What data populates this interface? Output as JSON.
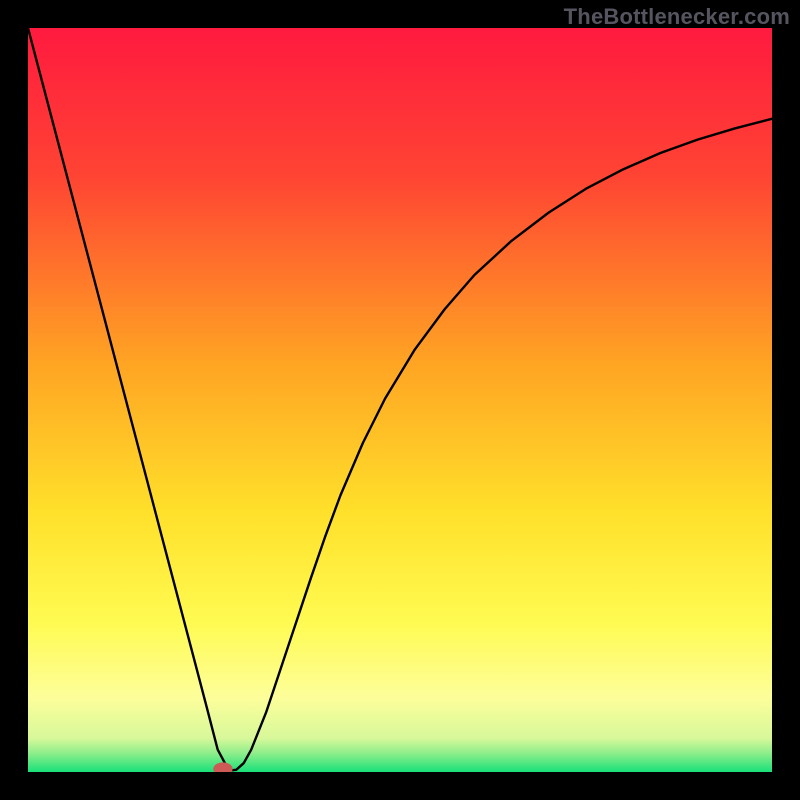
{
  "watermark": "TheBottlenecker.com",
  "chart_data": {
    "type": "line",
    "title": "",
    "xlabel": "",
    "ylabel": "",
    "xlim": [
      0,
      100
    ],
    "ylim": [
      0,
      100
    ],
    "grid": false,
    "legend": false,
    "background": {
      "type": "vertical-gradient",
      "stops": [
        {
          "pos": 0.0,
          "color": "#ff1a3f"
        },
        {
          "pos": 0.2,
          "color": "#ff4433"
        },
        {
          "pos": 0.45,
          "color": "#ffa423"
        },
        {
          "pos": 0.65,
          "color": "#ffe02a"
        },
        {
          "pos": 0.8,
          "color": "#fffb52"
        },
        {
          "pos": 0.9,
          "color": "#fdfe9a"
        },
        {
          "pos": 0.955,
          "color": "#d7f89a"
        },
        {
          "pos": 0.975,
          "color": "#8dee8a"
        },
        {
          "pos": 1.0,
          "color": "#18e07a"
        }
      ]
    },
    "series": [
      {
        "name": "bottleneck-curve",
        "stroke": "#000000",
        "stroke_width": 2.4,
        "x": [
          0,
          2,
          4,
          6,
          8,
          10,
          12,
          14,
          16,
          18,
          20,
          22,
          24,
          25.5,
          27,
          28,
          29,
          30,
          32,
          34,
          36,
          38,
          40,
          42,
          45,
          48,
          52,
          56,
          60,
          65,
          70,
          75,
          80,
          85,
          90,
          95,
          100
        ],
        "y": [
          100,
          92.4,
          84.8,
          77.2,
          69.6,
          62.0,
          54.4,
          46.8,
          39.2,
          31.6,
          24.0,
          16.4,
          8.8,
          3.0,
          0.2,
          0.3,
          1.2,
          3.0,
          8.0,
          14.0,
          20.0,
          26.0,
          31.8,
          37.2,
          44.2,
          50.2,
          56.8,
          62.2,
          66.8,
          71.4,
          75.2,
          78.4,
          81.0,
          83.2,
          85.0,
          86.5,
          87.8
        ]
      }
    ],
    "marker": {
      "name": "min-point",
      "x": 26.2,
      "y": 0.4,
      "rx": 1.3,
      "ry": 0.9,
      "fill": "#cd5a54"
    }
  }
}
